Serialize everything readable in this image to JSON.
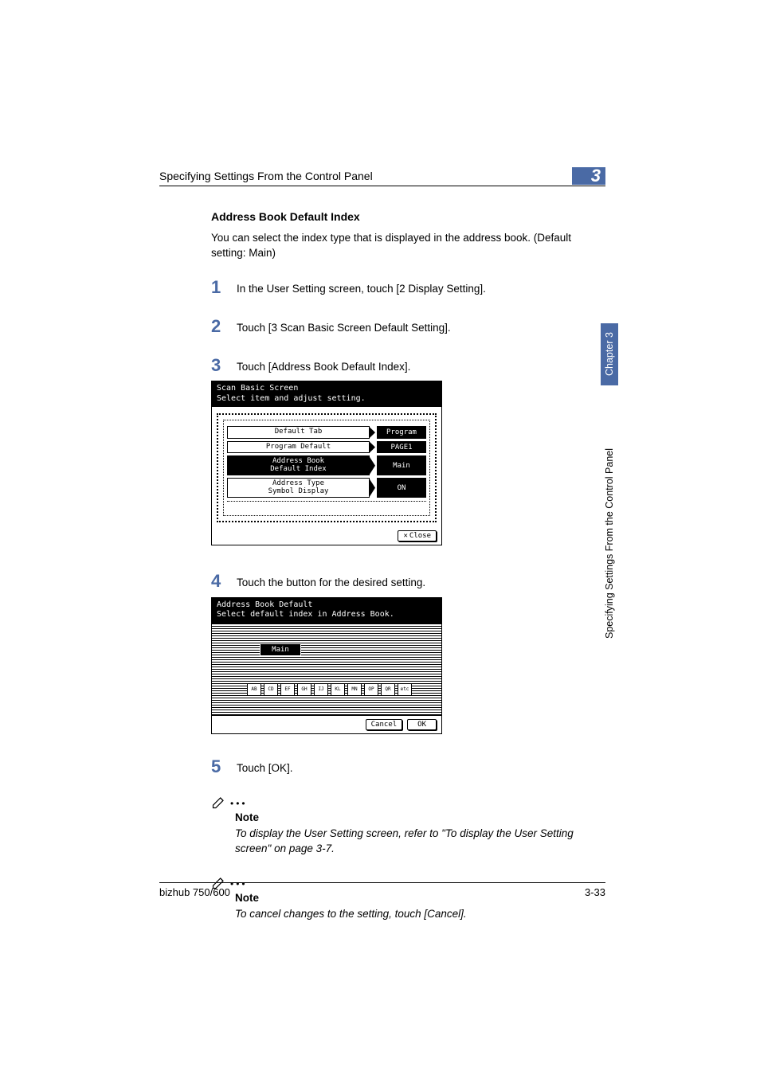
{
  "running_head": "Specifying Settings From the Control Panel",
  "chapter_number": "3",
  "section_title": "Address Book Default Index",
  "intro": "You can select the index type that is displayed in the address book. (Default setting: Main)",
  "steps": {
    "s1": "In the User Setting screen, touch [2 Display Setting].",
    "s2": "Touch [3 Scan Basic Screen Default Setting].",
    "s3": "Touch [Address Book Default Index].",
    "s4": "Touch the button for the desired setting.",
    "s5": "Touch [OK]."
  },
  "step_numbers": {
    "n1": "1",
    "n2": "2",
    "n3": "3",
    "n4": "4",
    "n5": "5"
  },
  "screen1": {
    "title_line1": "Scan Basic Screen",
    "title_line2": "Select item and adjust setting.",
    "rows": {
      "r1_label": "Default Tab",
      "r1_value": "Program",
      "r2_label": "Program Default",
      "r2_value": "PAGE1",
      "r3_label_a": "Address Book",
      "r3_label_b": "Default Index",
      "r3_value": "Main",
      "r4_label_a": "Address Type",
      "r4_label_b": "Symbol Display",
      "r4_value": "ON"
    },
    "close_btn": "Close"
  },
  "screen2": {
    "title_line1": "Address Book Default",
    "title_line2": "Select default index in Address Book.",
    "main_btn": "Main",
    "keys": [
      "AB",
      "CD",
      "EF",
      "GH",
      "IJ",
      "KL",
      "MN",
      "OP",
      "QR",
      "etc"
    ],
    "cancel_btn": "Cancel",
    "ok_btn": "OK"
  },
  "notes": {
    "label": "Note",
    "text1": "To display the User Setting screen, refer to \"To display the User Setting screen\" on page 3-7.",
    "text2": "To cancel changes to the setting, touch [Cancel]."
  },
  "footer": {
    "product": "bizhub 750/600",
    "page": "3-33"
  },
  "side": {
    "chapter": "Chapter 3",
    "title": "Specifying Settings From the Control Panel"
  }
}
